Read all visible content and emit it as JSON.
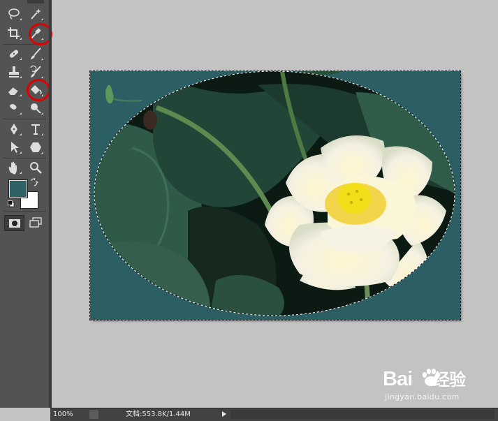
{
  "tools": {
    "top": "move-tool",
    "rows": [
      [
        "lasso-tool",
        "magic-wand-tool"
      ],
      [
        "crop-tool",
        "eyedropper-tool"
      ],
      [
        "spot-healing-brush-tool",
        "brush-tool"
      ],
      [
        "clone-stamp-tool",
        "history-brush-tool"
      ],
      [
        "eraser-tool",
        "paint-bucket-tool"
      ],
      [
        "blur-tool",
        "dodge-tool"
      ],
      [
        "pen-tool",
        "type-tool"
      ],
      [
        "path-selection-tool",
        "custom-shape-tool"
      ],
      [
        "hand-tool",
        "zoom-tool"
      ]
    ],
    "highlighted": [
      "eyedropper-tool",
      "paint-bucket-tool"
    ],
    "highlight_color": "#e10000"
  },
  "colors": {
    "foreground": "#2f6264",
    "background": "#ffffff"
  },
  "canvas": {
    "fill_color": "#2c5f64",
    "selection": "ellipse-marquee"
  },
  "statusbar": {
    "zoom": "100%",
    "doc_size": "文档:553.8K/1.44M"
  },
  "watermark": {
    "brand": "Bai",
    "brand_cn": "经验",
    "url": "jingyan.baidu.com"
  }
}
